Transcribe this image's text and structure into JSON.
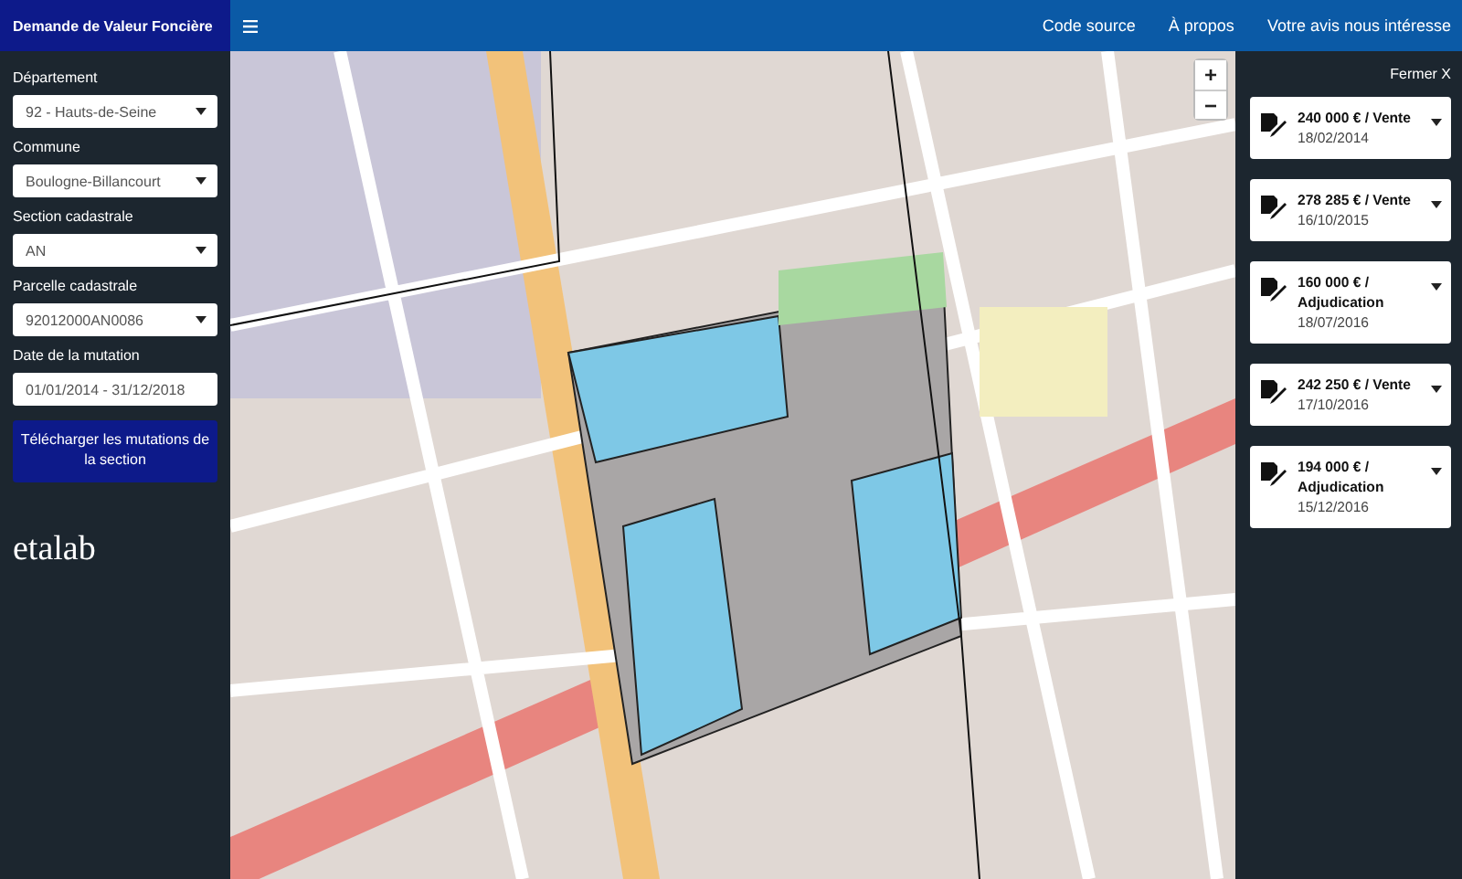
{
  "header": {
    "title": "Demande de Valeur Foncière",
    "links": [
      "Code source",
      "À propos",
      "Votre avis nous intéresse"
    ]
  },
  "sidebar": {
    "fields": [
      {
        "label": "Département",
        "value": "92 - Hauts-de-Seine",
        "kind": "select"
      },
      {
        "label": "Commune",
        "value": "Boulogne-Billancourt",
        "kind": "select"
      },
      {
        "label": "Section cadastrale",
        "value": "AN",
        "kind": "select"
      },
      {
        "label": "Parcelle cadastrale",
        "value": "92012000AN0086",
        "kind": "select"
      },
      {
        "label": "Date de la mutation",
        "value": "01/01/2014 - 31/12/2018",
        "kind": "input"
      }
    ],
    "button": "Télécharger les mutations de la section",
    "logo": "etalab"
  },
  "map": {
    "zoom_in": "+",
    "zoom_out": "−"
  },
  "panel": {
    "close": "Fermer X",
    "mutations": [
      {
        "title": "240 000 € / Vente",
        "date": "18/02/2014"
      },
      {
        "title": "278 285 € / Vente",
        "date": "16/10/2015"
      },
      {
        "title": "160 000 € / Adjudication",
        "date": "18/07/2016"
      },
      {
        "title": "242 250 € / Vente",
        "date": "17/10/2016"
      },
      {
        "title": "194 000 € / Adjudication",
        "date": "15/12/2016"
      }
    ]
  }
}
